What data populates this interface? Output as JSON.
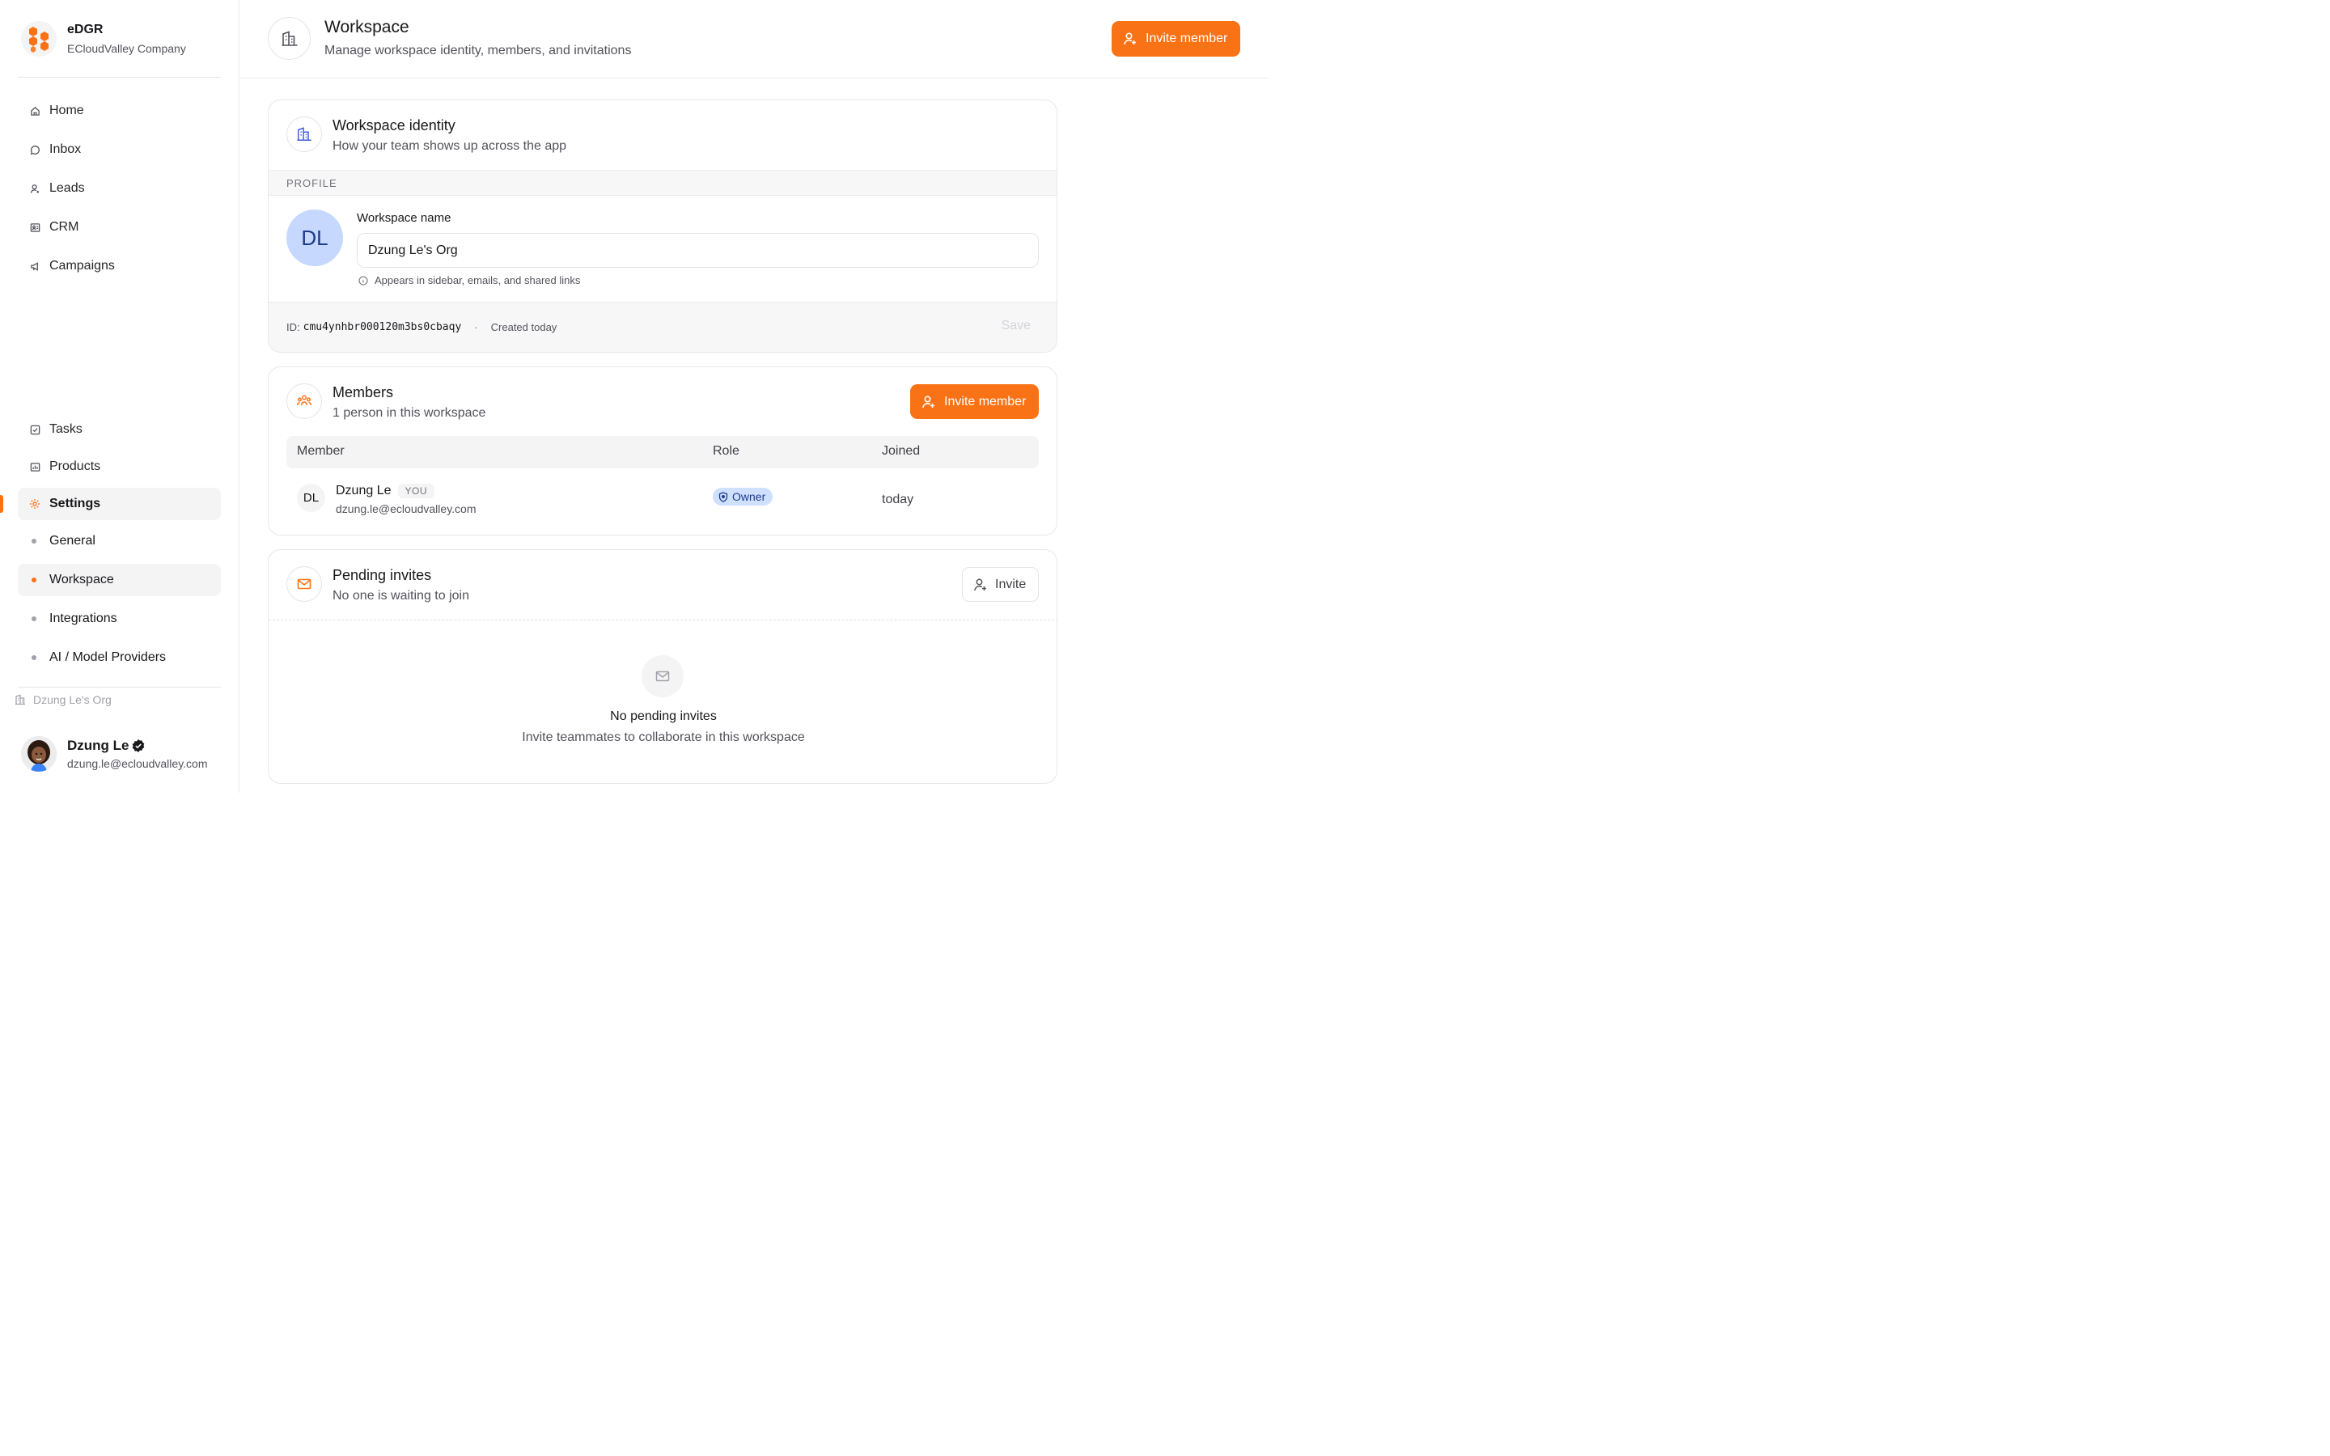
{
  "brand": {
    "name": "eDGR",
    "subtitle": "ECloudValley Company"
  },
  "nav": {
    "primary": [
      {
        "label": "Home",
        "icon": "home-icon"
      },
      {
        "label": "Inbox",
        "icon": "chat-icon"
      },
      {
        "label": "Leads",
        "icon": "user-icon"
      },
      {
        "label": "CRM",
        "icon": "contact-card-icon"
      },
      {
        "label": "Campaigns",
        "icon": "megaphone-icon"
      }
    ],
    "secondary": [
      {
        "label": "Tasks",
        "icon": "checkbox-icon"
      },
      {
        "label": "Products",
        "icon": "chart-icon"
      },
      {
        "label": "Settings",
        "icon": "gear-icon",
        "active": true
      }
    ],
    "settings_sub": [
      {
        "label": "General"
      },
      {
        "label": "Workspace",
        "active": true
      },
      {
        "label": "Integrations"
      },
      {
        "label": "AI / Model Providers"
      }
    ]
  },
  "sidebar_footer": {
    "org": "Dzung Le's Org",
    "user_name": "Dzung Le",
    "user_email": "dzung.le@ecloudvalley.com"
  },
  "header": {
    "title": "Workspace",
    "subtitle": "Manage workspace identity, members, and invitations",
    "invite_label": "Invite member"
  },
  "identity": {
    "title": "Workspace identity",
    "subtitle": "How your team shows up across the app",
    "section": "PROFILE",
    "avatar_initials": "DL",
    "field_label": "Workspace name",
    "field_value": "Dzung Le's Org",
    "hint": "Appears in sidebar, emails, and shared links",
    "id_label": "ID:",
    "id_value": "cmu4ynhbr000120m3bs0cbaqy",
    "separator": "·",
    "created": "Created today",
    "save_label": "Save"
  },
  "members": {
    "title": "Members",
    "subtitle": "1 person in this workspace",
    "invite_label": "Invite member",
    "columns": {
      "member": "Member",
      "role": "Role",
      "joined": "Joined"
    },
    "rows": [
      {
        "initials": "DL",
        "name": "Dzung Le",
        "badge": "YOU",
        "email": "dzung.le@ecloudvalley.com",
        "role": "Owner",
        "joined": "today"
      }
    ]
  },
  "invites": {
    "title": "Pending invites",
    "subtitle": "No one is waiting to join",
    "invite_label": "Invite",
    "empty_title": "No pending invites",
    "empty_sub": "Invite teammates to collaborate in this workspace"
  },
  "colors": {
    "accent": "#f97316",
    "avatar_bg": "#c7d8fe",
    "role_bg": "#cfe0fe"
  }
}
